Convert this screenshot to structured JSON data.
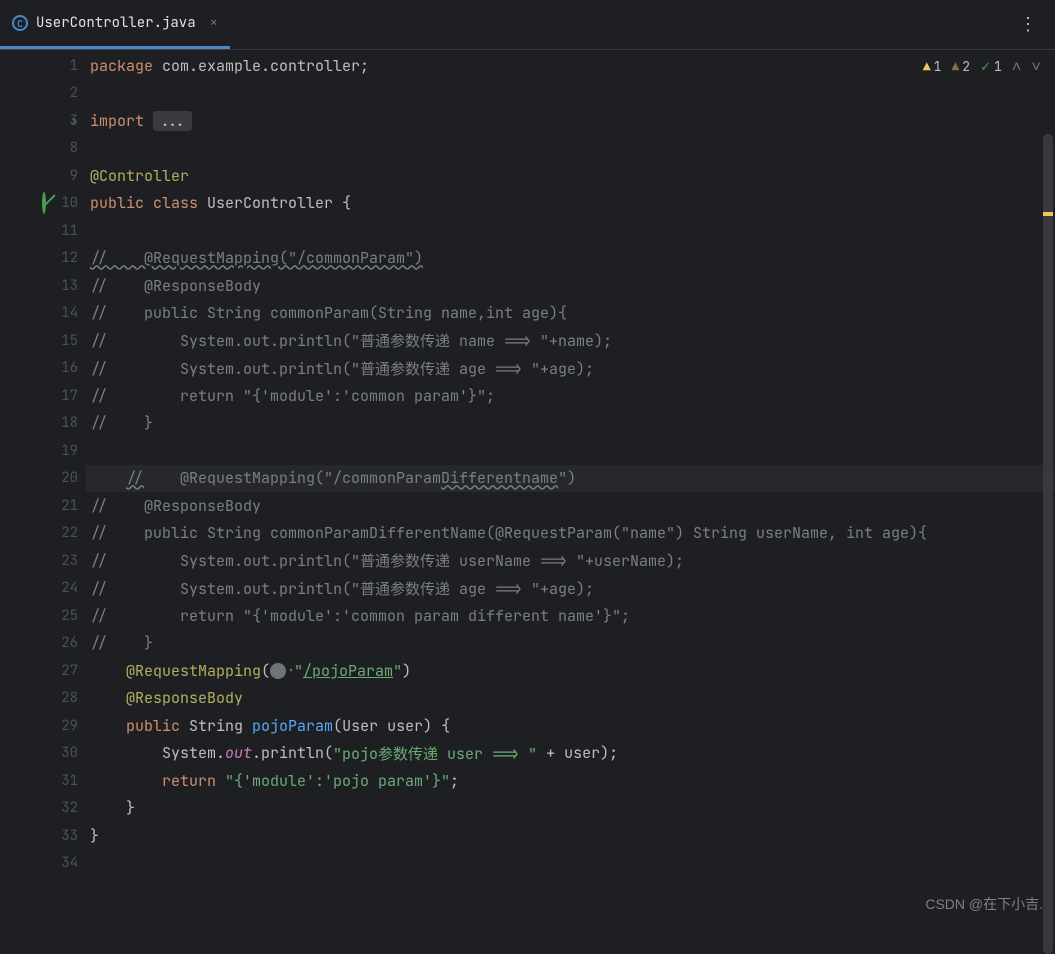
{
  "tab": {
    "filename": "UserController.java",
    "close_icon": "×"
  },
  "inspections": {
    "warn1": "1",
    "warn2": "2",
    "ok": "1"
  },
  "code": {
    "l1_package": "package",
    "l1_pkg": " com.example.controller;",
    "l3_import": "import",
    "l3_dots": "...",
    "l9_anno": "@Controller",
    "l10_public": "public ",
    "l10_class": "class ",
    "l10_name": "UserController ",
    "l10_brace": "{",
    "l12": "//    @RequestMapping(\"/commonParam\")",
    "l13": "//    @ResponseBody",
    "l14": "//    public String commonParam(String name,int age){",
    "l15": "//        System.out.println(\"普通参数传递 name ==> \"+name);",
    "l16": "//        System.out.println(\"普通参数传递 age ==> \"+age);",
    "l17": "//        return \"{'module':'common param'}\";",
    "l18": "//    }",
    "l20a": "    ",
    "l20b": "//",
    "l20c": "    @RequestMapping(\"/commonParam",
    "l20d": "Differentname",
    "l20e": "\")",
    "l21": "//    @ResponseBody",
    "l22": "//    public String commonParamDifferentName(@RequestParam(\"name\") String userName, int age){",
    "l23": "//        System.out.println(\"普通参数传递 userName ==> \"+userName);",
    "l24": "//        System.out.println(\"普通参数传递 age ==> \"+age);",
    "l25": "//        return \"{'module':'common param different name'}\";",
    "l26": "//    }",
    "l27_anno": "    @RequestMapping",
    "l27_paren": "(",
    "l27_url": "\"",
    "l27_link": "/pojoParam",
    "l27_urlend": "\"",
    "l27_close": ")",
    "l28": "    @ResponseBody",
    "l29_pub": "    public ",
    "l29_type": "String ",
    "l29_method": "pojoParam",
    "l29_paren": "(",
    "l29_ptype": "User user",
    "l29_close": ")",
    "l29_brace": " {",
    "l30_sys": "        System.",
    "l30_out": "out",
    "l30_println": ".println(",
    "l30_str": "\"pojo参数传递 user ==> \"",
    "l30_plus": " + user",
    "l30_end": ")",
    "l30_semi": ";",
    "l31_ret": "        return ",
    "l31_str": "\"{'module':'pojo param'}\"",
    "l31_semi": ";",
    "l32": "    }",
    "l33": "}"
  },
  "line_numbers": [
    "1",
    "2",
    "3",
    "8",
    "9",
    "10",
    "11",
    "12",
    "13",
    "14",
    "15",
    "16",
    "17",
    "18",
    "19",
    "20",
    "21",
    "22",
    "23",
    "24",
    "25",
    "26",
    "27",
    "28",
    "29",
    "30",
    "31",
    "32",
    "33",
    "34"
  ],
  "watermark": "CSDN @在下小吉."
}
